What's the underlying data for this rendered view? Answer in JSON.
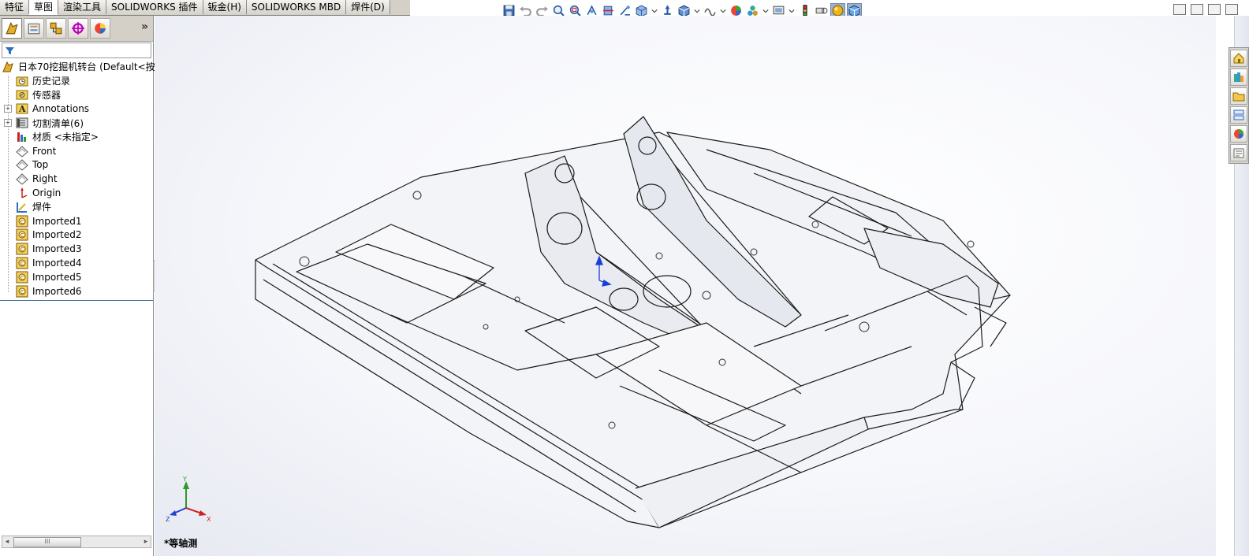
{
  "tabs": [
    {
      "label": "特征",
      "active": false
    },
    {
      "label": "草图",
      "active": true
    },
    {
      "label": "渲染工具",
      "active": false
    },
    {
      "label": "SOLIDWORKS 插件",
      "active": false
    },
    {
      "label": "钣金(H)",
      "active": false
    },
    {
      "label": "SOLIDWORKS MBD",
      "active": false
    },
    {
      "label": "焊件(D)",
      "active": false
    }
  ],
  "hud_icons": [
    "save-icon",
    "undo-icon",
    "redo-icon",
    "zoom-to-fit-icon",
    "zoom-to-area-icon",
    "previous-view-icon",
    "section-view-icon",
    "dynamic-annotation-icon",
    "view-orientation-icon",
    "display-style-icon",
    "hide-show-items-icon",
    "edit-appearance-icon",
    "apply-scene-icon",
    "view-settings-icon",
    "realview-icon",
    "shadows-icon",
    "ambient-occlusion-icon",
    "perspective-icon"
  ],
  "panel": {
    "more_glyph": "»",
    "tree": [
      {
        "label": "日本70挖掘机转台  (Default<按",
        "icon": "part-icon",
        "expander": "",
        "root": true
      },
      {
        "label": "历史记录",
        "icon": "history-folder-icon",
        "expander": ""
      },
      {
        "label": "传感器",
        "icon": "sensors-folder-icon",
        "expander": ""
      },
      {
        "label": "Annotations",
        "icon": "annotations-icon",
        "expander": "+"
      },
      {
        "label": "切割清单(6)",
        "icon": "cut-list-icon",
        "expander": "+"
      },
      {
        "label": "材质 <未指定>",
        "icon": "material-icon",
        "expander": ""
      },
      {
        "label": "Front",
        "icon": "plane-icon",
        "expander": ""
      },
      {
        "label": "Top",
        "icon": "plane-icon",
        "expander": ""
      },
      {
        "label": "Right",
        "icon": "plane-icon",
        "expander": ""
      },
      {
        "label": "Origin",
        "icon": "origin-icon",
        "expander": ""
      },
      {
        "label": "焊件",
        "icon": "weldment-icon",
        "expander": ""
      },
      {
        "label": "Imported1",
        "icon": "imported-body-icon",
        "expander": ""
      },
      {
        "label": "Imported2",
        "icon": "imported-body-icon",
        "expander": ""
      },
      {
        "label": "Imported3",
        "icon": "imported-body-icon",
        "expander": ""
      },
      {
        "label": "Imported4",
        "icon": "imported-body-icon",
        "expander": ""
      },
      {
        "label": "Imported5",
        "icon": "imported-body-icon",
        "expander": ""
      },
      {
        "label": "Imported6",
        "icon": "imported-body-icon",
        "expander": ""
      }
    ],
    "scroll_thumb_glyph": "III"
  },
  "viewport": {
    "view_name": "*等轴测",
    "triad": {
      "x": "X",
      "y": "Y",
      "z": "Z"
    }
  },
  "task_pane": [
    "home-icon",
    "design-library-icon",
    "file-explorer-icon",
    "view-palette-icon",
    "appearances-icon",
    "custom-properties-icon"
  ],
  "colors": {
    "accent": "#3a6ea5",
    "panel_bg": "#d4d0c8"
  }
}
